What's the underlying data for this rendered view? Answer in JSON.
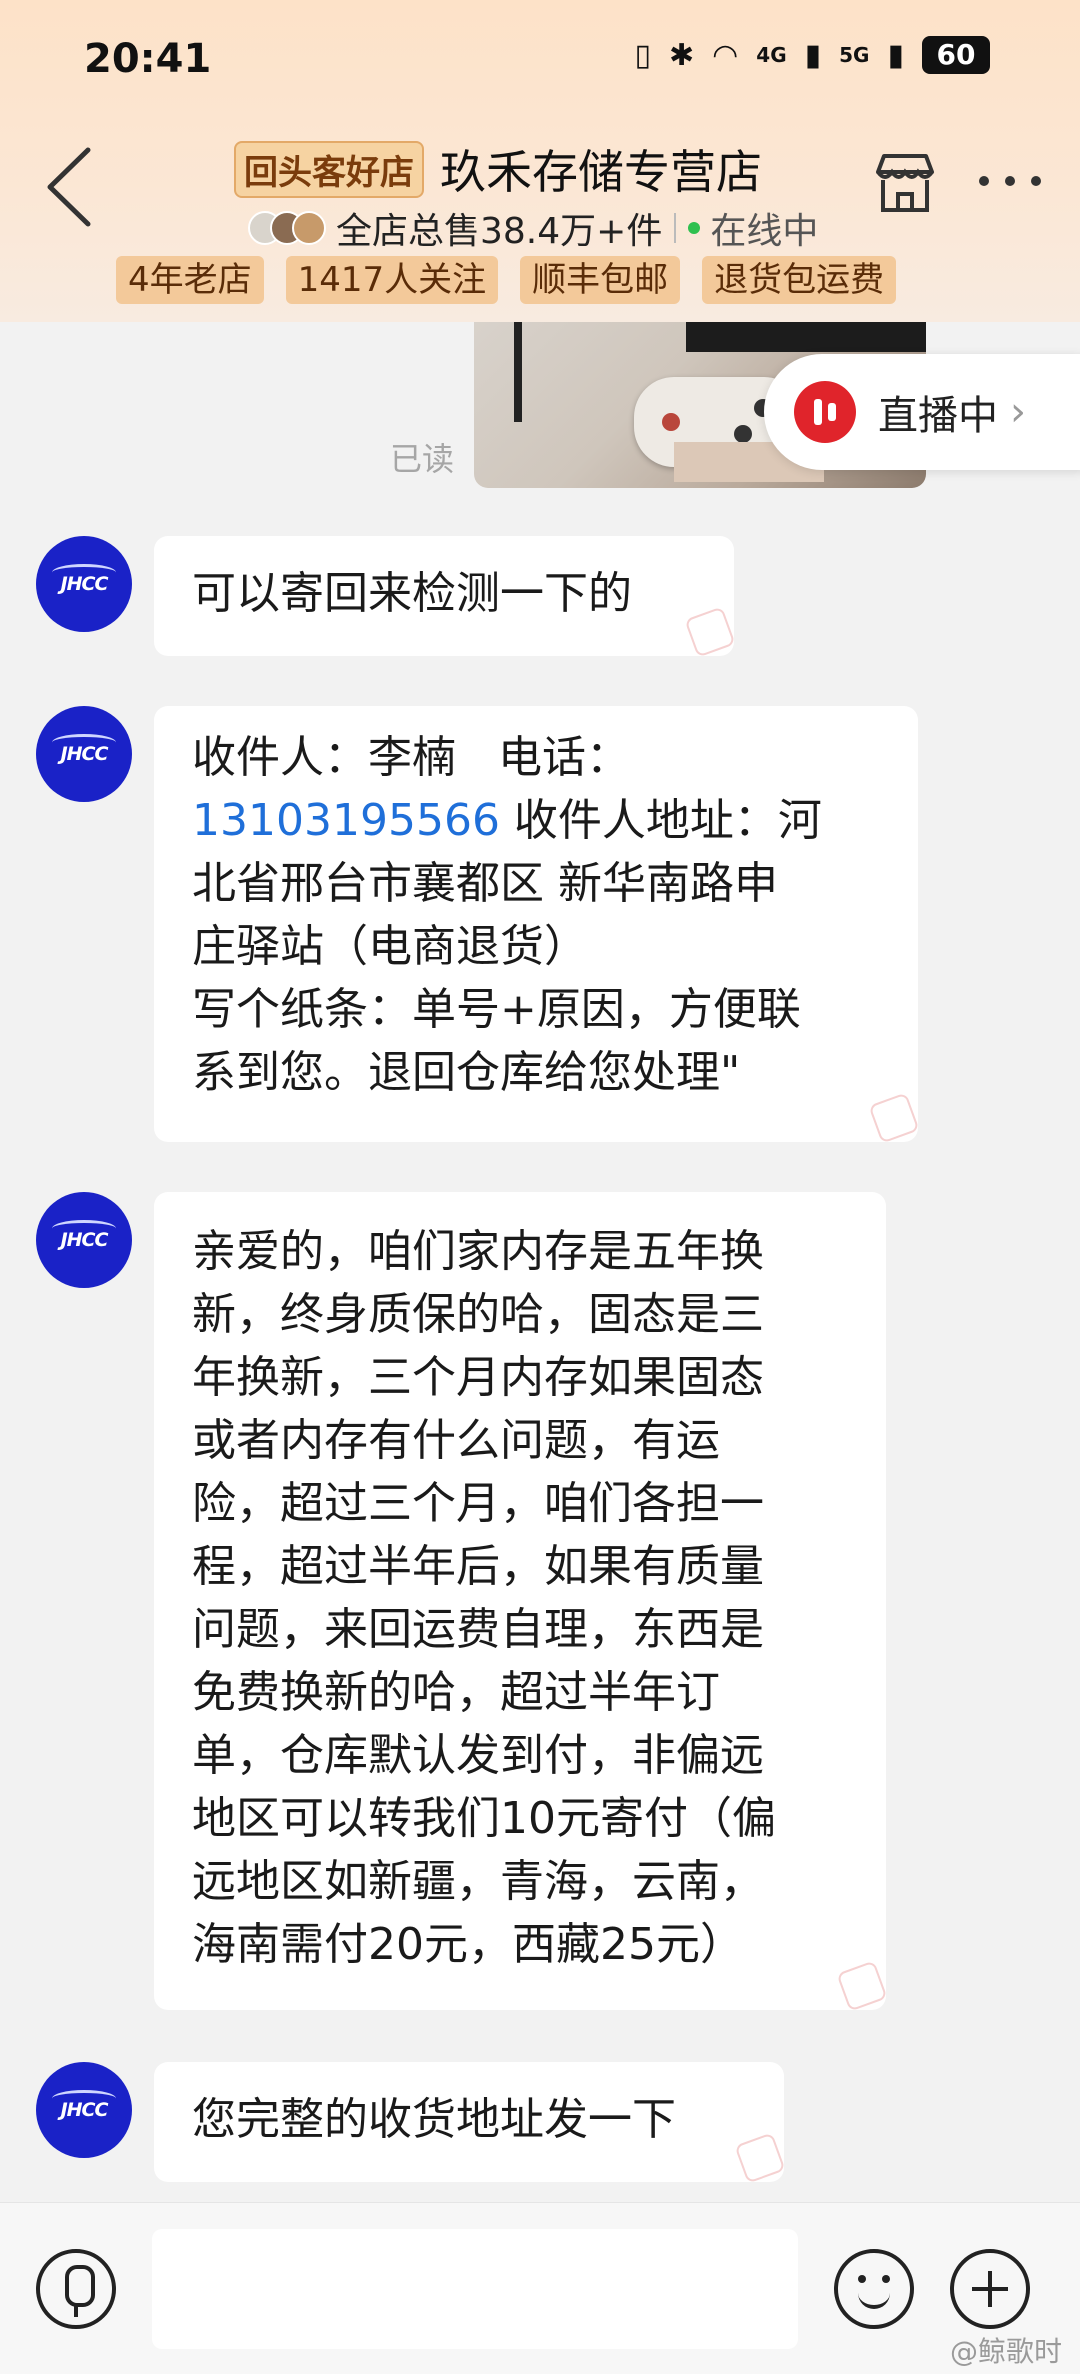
{
  "status_bar": {
    "time": "20:41",
    "signal_4g": "4G",
    "signal_5g": "5G",
    "battery": "60"
  },
  "header": {
    "store_tag": "回头客好店",
    "store_name": "玖禾存储专营店",
    "sales": "全店总售38.4万+件",
    "online_status": "在线中",
    "tags": [
      "4年老店",
      "1417人关注",
      "顺丰包邮",
      "退货包运费"
    ]
  },
  "chat": {
    "read_label": "已读",
    "live_button": "直播中",
    "messages": [
      {
        "lines": [
          "可以寄回来检测一下的"
        ]
      },
      {
        "line1": "收件人：李楠   电话：",
        "phone": "13103195566",
        "line2_rest": " 收件人地址：河",
        "line3": "北省邢台市襄都区 新华南路申",
        "line4": "庄驿站（电商退货）",
        "line5": "写个纸条：单号+原因，方便联",
        "line6": "系到您。退回仓库给您处理\""
      },
      {
        "lines": [
          "亲爱的，咱们家内存是五年换",
          "新，终身质保的哈，固态是三",
          "年换新，三个月内存如果固态",
          "或者内存有什么问题，有运",
          "险，超过三个月，咱们各担一",
          "程，超过半年后，如果有质量",
          "问题，来回运费自理，东西是",
          "免费换新的哈，超过半年订",
          "单，仓库默认发到付，非偏远",
          "地区可以转我们10元寄付（偏",
          "远地区如新疆，青海，云南，",
          "海南需付20元，西藏25元）"
        ]
      },
      {
        "lines": [
          "您完整的收货地址发一下"
        ]
      }
    ],
    "avatar_logo": "JHCC"
  },
  "input": {
    "placeholder": ""
  },
  "watermark": "@鲸歌时"
}
